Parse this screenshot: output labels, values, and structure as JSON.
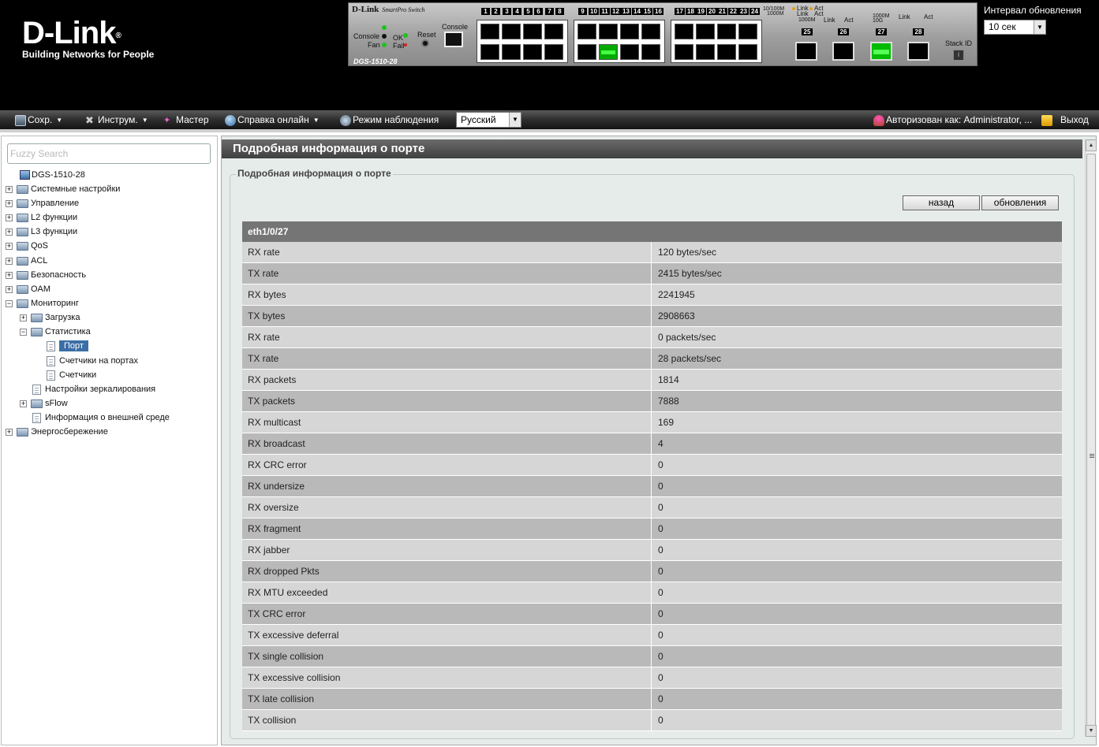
{
  "header": {
    "brand": "D-Link",
    "tagline": "Building Networks for People",
    "panel": {
      "model_top": "D-Link",
      "model_series": "SmartPro Switch",
      "model_bottom": "DGS-1510-28",
      "console_label": "Console",
      "fan_label": "Fan",
      "ok_label": "OK",
      "fail_label": "Fail",
      "reset_label": "Reset",
      "console_port_label": "Console",
      "port_numbers": [
        "1",
        "2",
        "3",
        "4",
        "5",
        "6",
        "7",
        "8",
        "9",
        "10",
        "11",
        "12",
        "13",
        "14",
        "15",
        "16",
        "17",
        "18",
        "19",
        "20",
        "21",
        "22",
        "23",
        "24"
      ],
      "sfp_numbers": [
        "25",
        "26",
        "27",
        "28"
      ],
      "legend_1": "10/100M",
      "legend_2": "1000M",
      "legend_link": "Link",
      "legend_act": "Act",
      "legend_3": "1000M",
      "legend_4": "1000M",
      "legend_5": "10G",
      "stack_id": "Stack ID",
      "active_port": "12",
      "active_sfp": "27"
    },
    "refresh": {
      "label": "Интервал обновления",
      "value": "10 сек"
    }
  },
  "toolbar": {
    "save": "Сохр.",
    "tools": "Инструм.",
    "wizard": "Мастер",
    "help": "Справка онлайн",
    "monitor_mode": "Режим наблюдения",
    "language": "Русский",
    "logged_in": "Авторизован как: Administrator, ...",
    "logout": "Выход"
  },
  "sidebar": {
    "search_placeholder": "Fuzzy Search",
    "tree": {
      "root": "DGS-1510-28",
      "system": "Системные настройки",
      "management": "Управление",
      "l2": "L2 функции",
      "l3": "L3 функции",
      "qos": "QoS",
      "acl": "ACL",
      "security": "Безопасность",
      "oam": "OAM",
      "monitoring": "Мониторинг",
      "load": "Загрузка",
      "statistics": "Статистика",
      "port": "Порт",
      "port_counters": "Счетчики на портах",
      "counters": "Счетчики",
      "mirroring": "Настройки зеркалирования",
      "sflow": "sFlow",
      "environment": "Информация о внешней среде",
      "power_saving": "Энергосбережение"
    }
  },
  "main": {
    "title": "Подробная информация о порте",
    "legend": "Подробная информация о порте",
    "back_button": "назад",
    "refresh_button": "обновления",
    "table_header": "eth1/0/27",
    "rows": [
      {
        "k": "RX rate",
        "v": "120 bytes/sec"
      },
      {
        "k": "TX rate",
        "v": "2415 bytes/sec"
      },
      {
        "k": "RX bytes",
        "v": "2241945"
      },
      {
        "k": "TX bytes",
        "v": "2908663"
      },
      {
        "k": "RX rate",
        "v": "0 packets/sec"
      },
      {
        "k": "TX rate",
        "v": "28 packets/sec"
      },
      {
        "k": "RX packets",
        "v": "1814"
      },
      {
        "k": "TX packets",
        "v": "7888"
      },
      {
        "k": "RX multicast",
        "v": "169"
      },
      {
        "k": "RX broadcast",
        "v": "4"
      },
      {
        "k": "RX CRC error",
        "v": "0"
      },
      {
        "k": "RX undersize",
        "v": "0"
      },
      {
        "k": "RX oversize",
        "v": "0"
      },
      {
        "k": "RX fragment",
        "v": "0"
      },
      {
        "k": "RX jabber",
        "v": "0"
      },
      {
        "k": "RX dropped Pkts",
        "v": "0"
      },
      {
        "k": "RX MTU exceeded",
        "v": "0"
      },
      {
        "k": "TX CRC error",
        "v": "0"
      },
      {
        "k": "TX excessive deferral",
        "v": "0"
      },
      {
        "k": "TX single collision",
        "v": "0"
      },
      {
        "k": "TX excessive collision",
        "v": "0"
      },
      {
        "k": "TX late collision",
        "v": "0"
      },
      {
        "k": "TX collision",
        "v": "0"
      }
    ]
  },
  "colors": {
    "header_bg": "#000000",
    "title_bar": "#4a4a4a",
    "table_header": "#757575",
    "row_light": "#d6d6d6",
    "row_dark": "#b9b9b9",
    "selected_tree": "#3b6ea5"
  }
}
